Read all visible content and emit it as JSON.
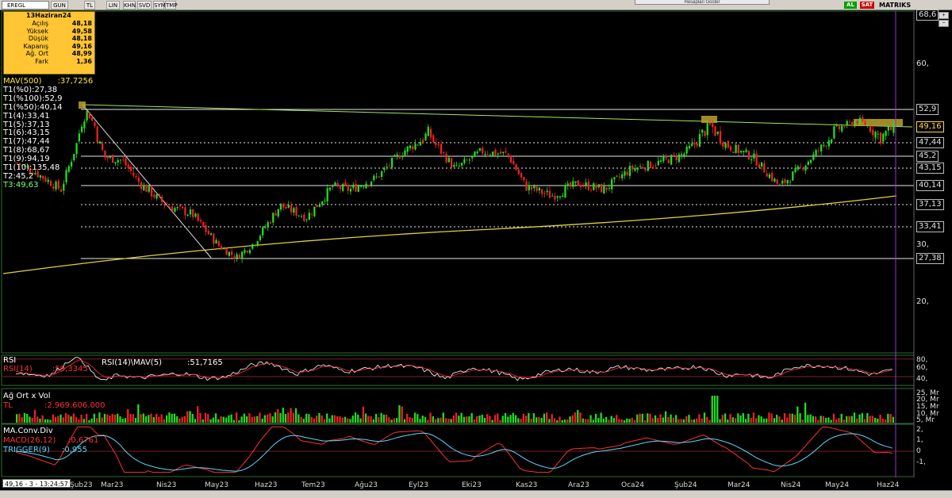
{
  "toolbar": {
    "symbol": "EREGL",
    "buttons": [
      "GUN",
      "TL",
      "LIN",
      "KHN",
      "SVD",
      "SYM",
      "TMP"
    ],
    "hint": "Hesaplari Goster",
    "tags": [
      "AL",
      "SAT"
    ],
    "matriks": "MATRIKS"
  },
  "info": {
    "date": "13Haziran24",
    "rows": [
      {
        "label": "Açılış",
        "value": "48,18"
      },
      {
        "label": "Yüksek",
        "value": "49,58"
      },
      {
        "label": "Düşük",
        "value": "48,18"
      },
      {
        "label": "Kapanış",
        "value": "49,16"
      },
      {
        "label": "Ağ. Ort",
        "value": "48,99"
      },
      {
        "label": "Fark",
        "value": "1,36"
      }
    ]
  },
  "legend": [
    {
      "text": "MAV(500)",
      "value": ":37,7256",
      "color": "#ffea3b"
    },
    {
      "text": "T1(%0):27,38",
      "color": "#ffffff"
    },
    {
      "text": "T1(%100):52,9",
      "color": "#ffffff"
    },
    {
      "text": "T1(%50):40,14",
      "color": "#ffffff"
    },
    {
      "text": "T1(4):33,41",
      "color": "#ffffff"
    },
    {
      "text": "T1(5):37,13",
      "color": "#ffffff"
    },
    {
      "text": "T1(6):43,15",
      "color": "#ffffff"
    },
    {
      "text": "T1(7):47,44",
      "color": "#ffffff"
    },
    {
      "text": "T1(8):68,67",
      "color": "#ffffff"
    },
    {
      "text": "T1(9):94,19",
      "color": "#ffffff"
    },
    {
      "text": "T1(10):135,48",
      "color": "#ffffff"
    },
    {
      "text": "T2:45,2",
      "color": "#ffffff"
    },
    {
      "text": "T3:49,63",
      "color": "#80ff80"
    }
  ],
  "price_labels": [
    {
      "text": "68,6",
      "y": 68.6,
      "style": "box"
    },
    {
      "text": "60,",
      "y": 60,
      "style": "plain"
    },
    {
      "text": "52,9",
      "y": 52.9,
      "style": "box"
    },
    {
      "text": "49,16",
      "y": 49.16,
      "style": "hl"
    },
    {
      "text": "47,44",
      "y": 47.44,
      "style": "box"
    },
    {
      "text": "45,2",
      "y": 45.2,
      "style": "box"
    },
    {
      "text": "43,15",
      "y": 43.15,
      "style": "box"
    },
    {
      "text": "40,14",
      "y": 40.14,
      "style": "box"
    },
    {
      "text": "37,13",
      "y": 37.13,
      "style": "box"
    },
    {
      "text": "33,41",
      "y": 33.41,
      "style": "box"
    },
    {
      "text": "30,",
      "y": 30,
      "style": "plain"
    },
    {
      "text": "27,38",
      "y": 27.38,
      "style": "box"
    },
    {
      "text": "20,",
      "y": 20,
      "style": "plain"
    }
  ],
  "fib_levels": [
    {
      "y": 52.9,
      "style": "solid"
    },
    {
      "y": 47.44,
      "style": "dotted"
    },
    {
      "y": 45.2,
      "style": "solid"
    },
    {
      "y": 43.15,
      "style": "dotted"
    },
    {
      "y": 40.14,
      "style": "solid"
    },
    {
      "y": 37.13,
      "style": "dotted"
    },
    {
      "y": 33.41,
      "style": "dotted"
    },
    {
      "y": 27.38,
      "style": "solid"
    }
  ],
  "rsi": {
    "title": "RSI",
    "label": "RSI(14)",
    "value": ":59,3345",
    "mav_label": "RSI(14)\\MAV(5)",
    "mav_value": ":51,7165",
    "axis": [
      "80,",
      "60,",
      "40,"
    ]
  },
  "volume": {
    "title": "Ağ Ort x Vol",
    "unit": "TL",
    "value": ":2.969.606.000",
    "axis": [
      "25, Mr",
      "20, Mr",
      "15, Mr",
      "10, Mr",
      "5, Mr"
    ]
  },
  "macd": {
    "title": "MA.Conv.Div",
    "macd_label": "MACD(26,12)",
    "macd_value": ":0,6761",
    "trigger_label": "TRIGGER(9)",
    "trigger_value": ":0,955",
    "axis": [
      "2,",
      "1,",
      "0",
      "-1,"
    ]
  },
  "dates": [
    "Şub23",
    "Mar23",
    "Nis23",
    "May23",
    "Haz23",
    "Tem23",
    "Ağu23",
    "Eyl23",
    "Eki23",
    "Kas23",
    "Ara23",
    "Oca24",
    "Şub24",
    "Mar24",
    "Nis24",
    "May24",
    "Haz24"
  ],
  "status": "49,16 - 3 - 13:24:57",
  "chart_data": {
    "type": "candlestick",
    "title": "EREGL",
    "x": [
      "Şub23",
      "Mar23",
      "Nis23",
      "May23",
      "Haz23",
      "Tem23",
      "Ağu23",
      "Eyl23",
      "Eki23",
      "Kas23",
      "Ara23",
      "Oca24",
      "Şub24",
      "Mar24",
      "Nis24",
      "May24",
      "Haz24"
    ],
    "close_approx": [
      44.5,
      41.0,
      35.5,
      29.5,
      36.0,
      39.0,
      43.5,
      47.0,
      42.0,
      39.0,
      41.5,
      43.5,
      47.5,
      44.5,
      40.0,
      46.0,
      49.16
    ],
    "ylim": [
      15,
      70
    ],
    "mav500": [
      31.0,
      32.5,
      34.0,
      35.5,
      37.7256
    ]
  }
}
